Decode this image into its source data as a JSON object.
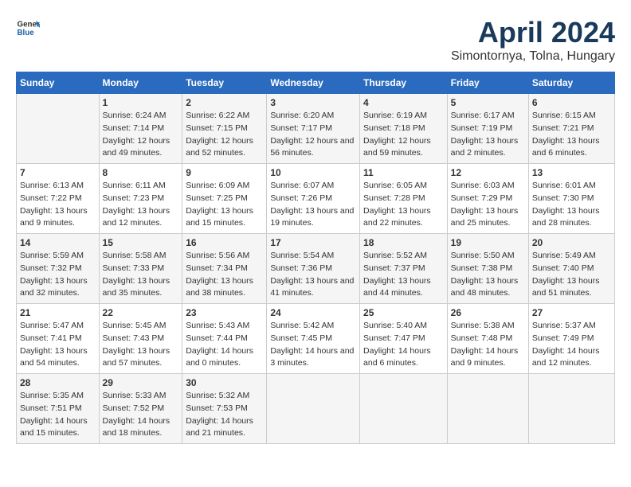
{
  "header": {
    "logo_general": "General",
    "logo_blue": "Blue",
    "main_title": "April 2024",
    "subtitle": "Simontornya, Tolna, Hungary"
  },
  "calendar": {
    "days_of_week": [
      "Sunday",
      "Monday",
      "Tuesday",
      "Wednesday",
      "Thursday",
      "Friday",
      "Saturday"
    ],
    "weeks": [
      [
        {
          "day": "",
          "sunrise": "",
          "sunset": "",
          "daylight": ""
        },
        {
          "day": "1",
          "sunrise": "Sunrise: 6:24 AM",
          "sunset": "Sunset: 7:14 PM",
          "daylight": "Daylight: 12 hours and 49 minutes."
        },
        {
          "day": "2",
          "sunrise": "Sunrise: 6:22 AM",
          "sunset": "Sunset: 7:15 PM",
          "daylight": "Daylight: 12 hours and 52 minutes."
        },
        {
          "day": "3",
          "sunrise": "Sunrise: 6:20 AM",
          "sunset": "Sunset: 7:17 PM",
          "daylight": "Daylight: 12 hours and 56 minutes."
        },
        {
          "day": "4",
          "sunrise": "Sunrise: 6:19 AM",
          "sunset": "Sunset: 7:18 PM",
          "daylight": "Daylight: 12 hours and 59 minutes."
        },
        {
          "day": "5",
          "sunrise": "Sunrise: 6:17 AM",
          "sunset": "Sunset: 7:19 PM",
          "daylight": "Daylight: 13 hours and 2 minutes."
        },
        {
          "day": "6",
          "sunrise": "Sunrise: 6:15 AM",
          "sunset": "Sunset: 7:21 PM",
          "daylight": "Daylight: 13 hours and 6 minutes."
        }
      ],
      [
        {
          "day": "7",
          "sunrise": "Sunrise: 6:13 AM",
          "sunset": "Sunset: 7:22 PM",
          "daylight": "Daylight: 13 hours and 9 minutes."
        },
        {
          "day": "8",
          "sunrise": "Sunrise: 6:11 AM",
          "sunset": "Sunset: 7:23 PM",
          "daylight": "Daylight: 13 hours and 12 minutes."
        },
        {
          "day": "9",
          "sunrise": "Sunrise: 6:09 AM",
          "sunset": "Sunset: 7:25 PM",
          "daylight": "Daylight: 13 hours and 15 minutes."
        },
        {
          "day": "10",
          "sunrise": "Sunrise: 6:07 AM",
          "sunset": "Sunset: 7:26 PM",
          "daylight": "Daylight: 13 hours and 19 minutes."
        },
        {
          "day": "11",
          "sunrise": "Sunrise: 6:05 AM",
          "sunset": "Sunset: 7:28 PM",
          "daylight": "Daylight: 13 hours and 22 minutes."
        },
        {
          "day": "12",
          "sunrise": "Sunrise: 6:03 AM",
          "sunset": "Sunset: 7:29 PM",
          "daylight": "Daylight: 13 hours and 25 minutes."
        },
        {
          "day": "13",
          "sunrise": "Sunrise: 6:01 AM",
          "sunset": "Sunset: 7:30 PM",
          "daylight": "Daylight: 13 hours and 28 minutes."
        }
      ],
      [
        {
          "day": "14",
          "sunrise": "Sunrise: 5:59 AM",
          "sunset": "Sunset: 7:32 PM",
          "daylight": "Daylight: 13 hours and 32 minutes."
        },
        {
          "day": "15",
          "sunrise": "Sunrise: 5:58 AM",
          "sunset": "Sunset: 7:33 PM",
          "daylight": "Daylight: 13 hours and 35 minutes."
        },
        {
          "day": "16",
          "sunrise": "Sunrise: 5:56 AM",
          "sunset": "Sunset: 7:34 PM",
          "daylight": "Daylight: 13 hours and 38 minutes."
        },
        {
          "day": "17",
          "sunrise": "Sunrise: 5:54 AM",
          "sunset": "Sunset: 7:36 PM",
          "daylight": "Daylight: 13 hours and 41 minutes."
        },
        {
          "day": "18",
          "sunrise": "Sunrise: 5:52 AM",
          "sunset": "Sunset: 7:37 PM",
          "daylight": "Daylight: 13 hours and 44 minutes."
        },
        {
          "day": "19",
          "sunrise": "Sunrise: 5:50 AM",
          "sunset": "Sunset: 7:38 PM",
          "daylight": "Daylight: 13 hours and 48 minutes."
        },
        {
          "day": "20",
          "sunrise": "Sunrise: 5:49 AM",
          "sunset": "Sunset: 7:40 PM",
          "daylight": "Daylight: 13 hours and 51 minutes."
        }
      ],
      [
        {
          "day": "21",
          "sunrise": "Sunrise: 5:47 AM",
          "sunset": "Sunset: 7:41 PM",
          "daylight": "Daylight: 13 hours and 54 minutes."
        },
        {
          "day": "22",
          "sunrise": "Sunrise: 5:45 AM",
          "sunset": "Sunset: 7:43 PM",
          "daylight": "Daylight: 13 hours and 57 minutes."
        },
        {
          "day": "23",
          "sunrise": "Sunrise: 5:43 AM",
          "sunset": "Sunset: 7:44 PM",
          "daylight": "Daylight: 14 hours and 0 minutes."
        },
        {
          "day": "24",
          "sunrise": "Sunrise: 5:42 AM",
          "sunset": "Sunset: 7:45 PM",
          "daylight": "Daylight: 14 hours and 3 minutes."
        },
        {
          "day": "25",
          "sunrise": "Sunrise: 5:40 AM",
          "sunset": "Sunset: 7:47 PM",
          "daylight": "Daylight: 14 hours and 6 minutes."
        },
        {
          "day": "26",
          "sunrise": "Sunrise: 5:38 AM",
          "sunset": "Sunset: 7:48 PM",
          "daylight": "Daylight: 14 hours and 9 minutes."
        },
        {
          "day": "27",
          "sunrise": "Sunrise: 5:37 AM",
          "sunset": "Sunset: 7:49 PM",
          "daylight": "Daylight: 14 hours and 12 minutes."
        }
      ],
      [
        {
          "day": "28",
          "sunrise": "Sunrise: 5:35 AM",
          "sunset": "Sunset: 7:51 PM",
          "daylight": "Daylight: 14 hours and 15 minutes."
        },
        {
          "day": "29",
          "sunrise": "Sunrise: 5:33 AM",
          "sunset": "Sunset: 7:52 PM",
          "daylight": "Daylight: 14 hours and 18 minutes."
        },
        {
          "day": "30",
          "sunrise": "Sunrise: 5:32 AM",
          "sunset": "Sunset: 7:53 PM",
          "daylight": "Daylight: 14 hours and 21 minutes."
        },
        {
          "day": "",
          "sunrise": "",
          "sunset": "",
          "daylight": ""
        },
        {
          "day": "",
          "sunrise": "",
          "sunset": "",
          "daylight": ""
        },
        {
          "day": "",
          "sunrise": "",
          "sunset": "",
          "daylight": ""
        },
        {
          "day": "",
          "sunrise": "",
          "sunset": "",
          "daylight": ""
        }
      ]
    ]
  }
}
